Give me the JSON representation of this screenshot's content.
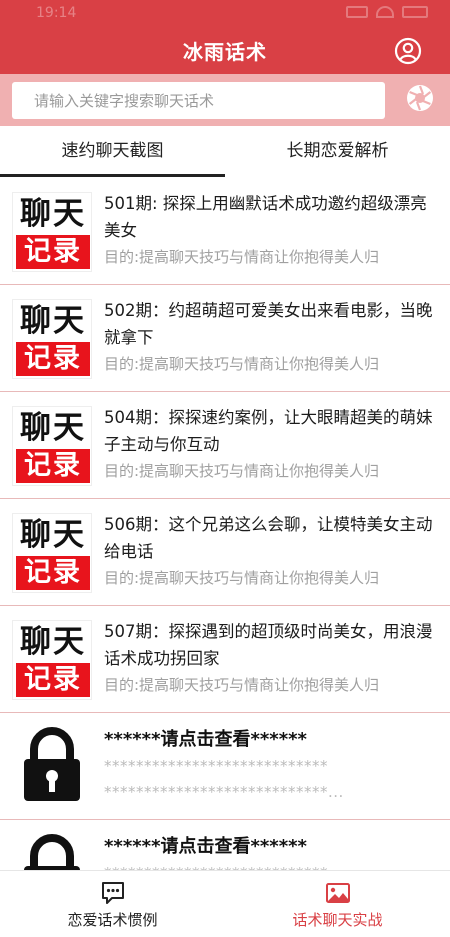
{
  "status_bar": {
    "time": "19:14"
  },
  "header": {
    "title": "冰雨话术",
    "profile_icon": "user-circle-icon"
  },
  "search": {
    "placeholder": "请输入关键字搜索聊天话术",
    "camera_icon": "camera-aperture-icon"
  },
  "tabs": [
    {
      "label": "速约聊天截图",
      "active": true
    },
    {
      "label": "长期恋爱解析",
      "active": false
    }
  ],
  "items": [
    {
      "thumb_top": "聊天",
      "thumb_bottom": "记录",
      "title": "501期: 探探上用幽默话术成功邀约超级漂亮美女",
      "subtitle": "目的:提高聊天技巧与情商让你抱得美人归"
    },
    {
      "thumb_top": "聊天",
      "thumb_bottom": "记录",
      "title": "502期：约超萌超可爱美女出来看电影，当晚就拿下",
      "subtitle": "目的:提高聊天技巧与情商让你抱得美人归"
    },
    {
      "thumb_top": "聊天",
      "thumb_bottom": "记录",
      "title": "504期：探探速约案例，让大眼睛超美的萌妹子主动与你互动",
      "subtitle": "目的:提高聊天技巧与情商让你抱得美人归"
    },
    {
      "thumb_top": "聊天",
      "thumb_bottom": "记录",
      "title": "506期：这个兄弟这么会聊，让模特美女主动给电话",
      "subtitle": "目的:提高聊天技巧与情商让你抱得美人归"
    },
    {
      "thumb_top": "聊天",
      "thumb_bottom": "记录",
      "title": "507期：探探遇到的超顶级时尚美女，用浪漫话术成功拐回家",
      "subtitle": "目的:提高聊天技巧与情商让你抱得美人归"
    }
  ],
  "locked_items": [
    {
      "title": "******请点击查看******",
      "mask_line1": "****************************",
      "mask_line2": "****************************..."
    },
    {
      "title": "******请点击查看******",
      "mask_line1": "****************************",
      "mask_line2": ""
    }
  ],
  "bottom_nav": [
    {
      "label": "恋爱话术惯例",
      "icon": "chat-bubble-icon",
      "active": false
    },
    {
      "label": "话术聊天实战",
      "icon": "image-icon",
      "active": true
    }
  ],
  "colors": {
    "primary": "#d94045",
    "search_bg": "#f0b0b1",
    "accent_red": "#e8141c",
    "active_nav": "#d94045",
    "subtitle": "#a0a0a0"
  }
}
